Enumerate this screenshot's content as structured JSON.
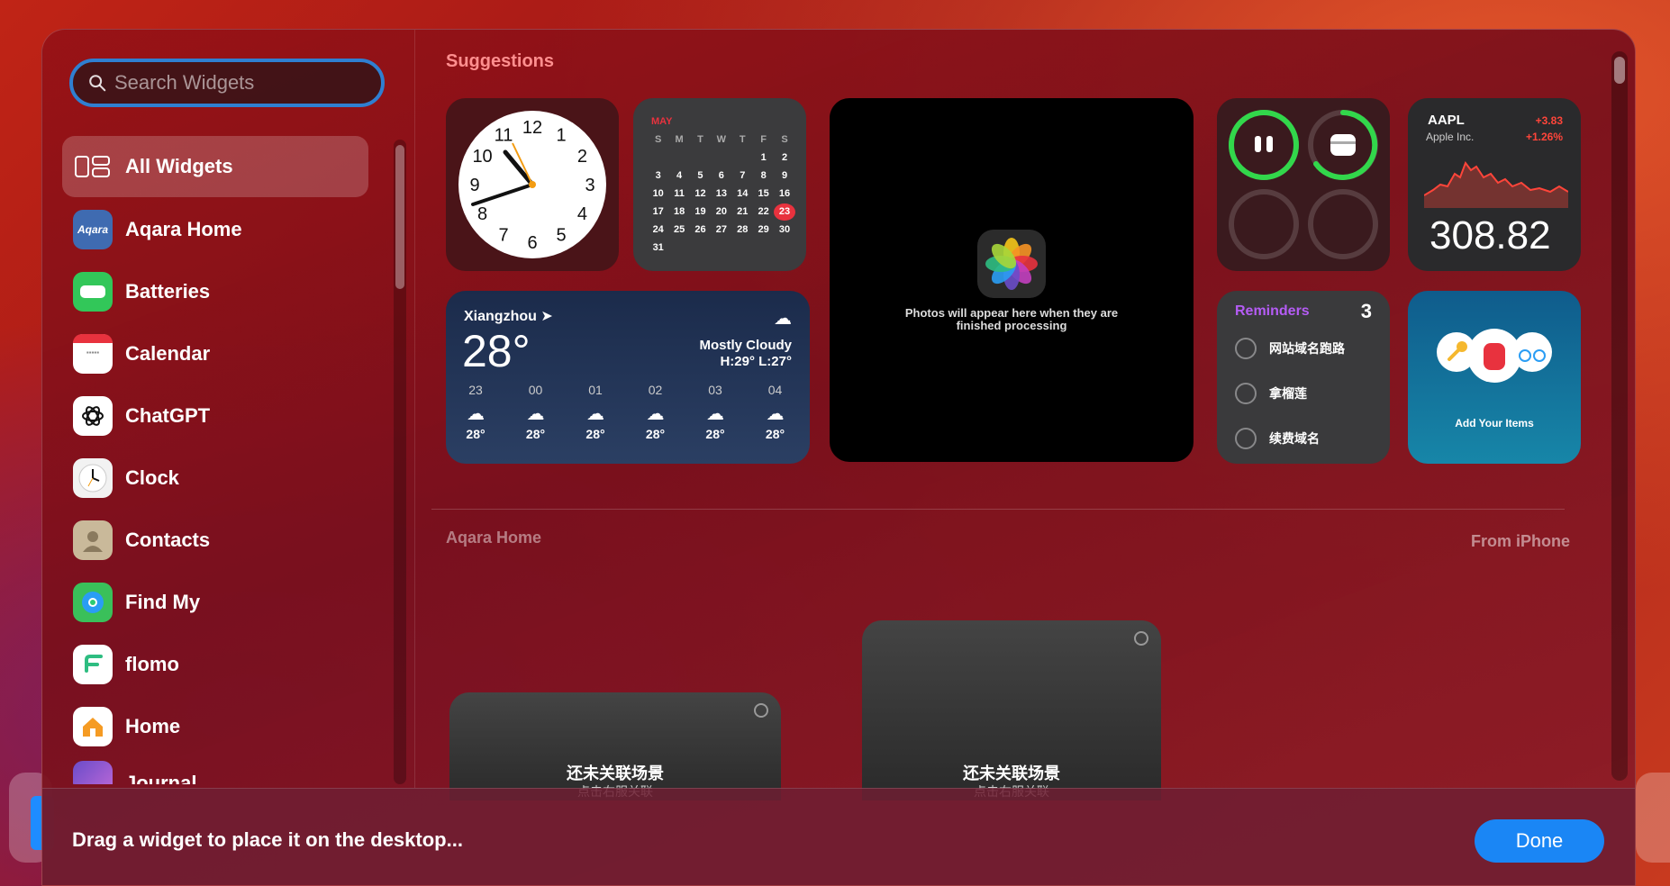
{
  "search": {
    "placeholder": "Search Widgets"
  },
  "sidebar": {
    "items": [
      {
        "label": "All Widgets",
        "active": true
      },
      {
        "label": "Aqara Home"
      },
      {
        "label": "Batteries"
      },
      {
        "label": "Calendar"
      },
      {
        "label": "ChatGPT"
      },
      {
        "label": "Clock"
      },
      {
        "label": "Contacts"
      },
      {
        "label": "Find My"
      },
      {
        "label": "flomo"
      },
      {
        "label": "Home"
      },
      {
        "label": "Journal"
      }
    ],
    "aqara_icon_text": "Aqara"
  },
  "suggestions": {
    "title": "Suggestions",
    "calendar": {
      "month": "MAY",
      "weekdays": [
        "S",
        "M",
        "T",
        "W",
        "T",
        "F",
        "S"
      ],
      "weeks": [
        [
          "",
          "",
          "",
          "",
          "",
          "1",
          "2"
        ],
        [
          "3",
          "4",
          "5",
          "6",
          "7",
          "8",
          "9"
        ],
        [
          "10",
          "11",
          "12",
          "13",
          "14",
          "15",
          "16"
        ],
        [
          "17",
          "18",
          "19",
          "20",
          "21",
          "22",
          "23"
        ],
        [
          "24",
          "25",
          "26",
          "27",
          "28",
          "29",
          "30"
        ],
        [
          "31",
          "",
          "",
          "",
          "",
          "",
          ""
        ]
      ],
      "today": "23"
    },
    "clock": {
      "numbers": [
        "12",
        "1",
        "2",
        "3",
        "4",
        "5",
        "6",
        "7",
        "8",
        "9",
        "10",
        "11"
      ]
    },
    "photos": {
      "message": "Photos will appear here when they are finished processing"
    },
    "stocks": {
      "symbol": "AAPL",
      "company": "Apple Inc.",
      "change": "+3.83",
      "change_pct": "+1.26%",
      "price": "308.82"
    },
    "weather": {
      "location": "Xiangzhou",
      "temp": "28°",
      "condition": "Mostly Cloudy",
      "hilo": "H:29° L:27°",
      "hours": [
        {
          "hour": "23",
          "temp": "28°"
        },
        {
          "hour": "00",
          "temp": "28°"
        },
        {
          "hour": "01",
          "temp": "28°"
        },
        {
          "hour": "02",
          "temp": "28°"
        },
        {
          "hour": "03",
          "temp": "28°"
        },
        {
          "hour": "04",
          "temp": "28°"
        }
      ]
    },
    "reminders": {
      "title": "Reminders",
      "count": "3",
      "items": [
        "网站域名跑路",
        "拿榴莲",
        "续费域名"
      ]
    },
    "findmy": {
      "label": "Add Your Items"
    }
  },
  "aqara_section": {
    "title": "Aqara Home",
    "source": "From iPhone",
    "widgets": [
      {
        "line1": "还未关联场景",
        "line2": "点击右服关联"
      },
      {
        "line1": "还未关联场景",
        "line2": "点击右服关联"
      }
    ]
  },
  "footer": {
    "message": "Drag a widget to place it on the desktop...",
    "done_label": "Done"
  },
  "colors": {
    "accent": "#1a86f5",
    "reminders_title": "#b55cf5",
    "calendar_today": "#e8323e"
  }
}
